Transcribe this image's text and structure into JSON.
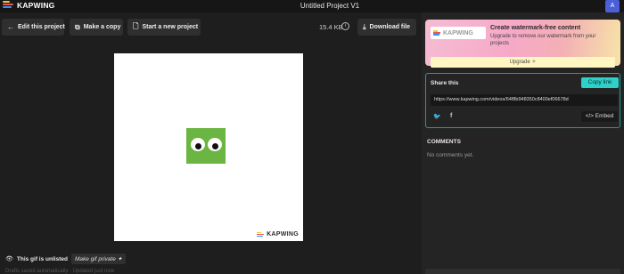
{
  "app": {
    "logo_text": "KAPWING",
    "project_title": "Untitled Project V1",
    "avatar_initial": "A"
  },
  "toolbar": {
    "edit_label": "Edit this project",
    "copy_label": "Make a copy",
    "new_label": "Start a new project",
    "file_size": "15.4 KB",
    "download_label": "Download file"
  },
  "canvas": {
    "watermark_text": "KAPWING"
  },
  "visibility": {
    "status": "This gif is unlisted",
    "make_private": "Make gif private ✦"
  },
  "upgrade": {
    "logo_text": "KAPWING",
    "title": "Create watermark-free content",
    "subtitle": "Upgrade to remove our watermark from your projects",
    "button": "Upgrade ✧"
  },
  "share": {
    "title": "Share this",
    "copy_link": "Copy link",
    "url": "https://www.kapwing.com/videos/64f8b948350c8400ef06678d",
    "embed": "Embed"
  },
  "comments": {
    "heading": "COMMENTS",
    "empty": "No comments yet."
  },
  "footer": {
    "faded": "Drafts saved automatically · Updated just now"
  },
  "colors": {
    "accent": "#2fd0c8",
    "frog": "#6bb543",
    "avatar": "#4b5fd6"
  }
}
